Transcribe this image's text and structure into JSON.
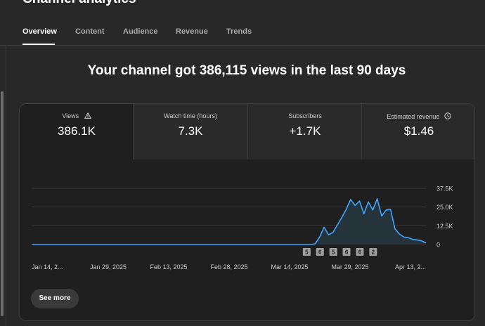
{
  "app": {
    "title": "Channel analytics"
  },
  "tabs": [
    {
      "label": "Overview",
      "active": true
    },
    {
      "label": "Content",
      "active": false
    },
    {
      "label": "Audience",
      "active": false
    },
    {
      "label": "Revenue",
      "active": false
    },
    {
      "label": "Trends",
      "active": false
    }
  ],
  "headline": "Your channel got 386,115 views in the last 90 days",
  "metrics": [
    {
      "label": "Views",
      "value": "386.1K",
      "icon": "warning-icon"
    },
    {
      "label": "Watch time (hours)",
      "value": "7.3K",
      "icon": ""
    },
    {
      "label": "Subscribers",
      "value": "+1.7K",
      "icon": ""
    },
    {
      "label": "Estimated revenue",
      "value": "$1.46",
      "icon": "clock-icon"
    }
  ],
  "see_more_label": "See more",
  "colors": {
    "line": "#3ea6ff",
    "area": "#25333a",
    "gridline": "#3a3a3a",
    "background": "#1f1f1f"
  },
  "chart_data": {
    "type": "area",
    "series": [
      {
        "values": [
          0,
          0,
          0,
          0,
          0,
          0,
          0,
          0,
          0,
          0,
          0,
          0,
          0,
          0,
          0,
          0,
          0,
          0,
          0,
          0,
          0,
          0,
          0,
          0,
          0,
          0,
          0,
          0,
          0,
          0,
          0,
          0,
          0,
          0,
          0,
          0,
          0,
          0,
          0,
          0,
          0,
          0,
          0,
          0,
          0,
          0,
          0,
          0,
          0,
          0,
          0,
          0,
          0,
          0,
          0,
          0,
          0,
          0,
          0,
          0,
          0,
          0,
          0,
          0,
          500,
          5000,
          11500,
          6500,
          8000,
          13000,
          18000,
          23500,
          30000,
          26000,
          29000,
          20500,
          28500,
          23000,
          30500,
          19000,
          23000,
          23500,
          10500,
          7000,
          5000,
          4500,
          3500,
          3000,
          2500,
          1000
        ]
      }
    ],
    "x_start": "2025-01-13",
    "x_tick_labels": [
      "Jan 14, 2...",
      "Jan 29, 2025",
      "Feb 13, 2025",
      "Feb 28, 2025",
      "Mar 14, 2025",
      "Mar 29, 2025",
      "Apr 13, 2..."
    ],
    "y_tick_labels": [
      "37.5K",
      "25.0K",
      "12.5K",
      "0"
    ],
    "ylim": [
      0,
      37500
    ],
    "grid": true,
    "markers": [
      {
        "label": "5",
        "date": "2025-03-16"
      },
      {
        "label": "6",
        "date": "2025-03-19"
      },
      {
        "label": "5",
        "date": "2025-03-22"
      },
      {
        "label": "6",
        "date": "2025-03-25"
      },
      {
        "label": "6",
        "date": "2025-03-28"
      },
      {
        "label": "2",
        "date": "2025-03-31"
      }
    ]
  }
}
